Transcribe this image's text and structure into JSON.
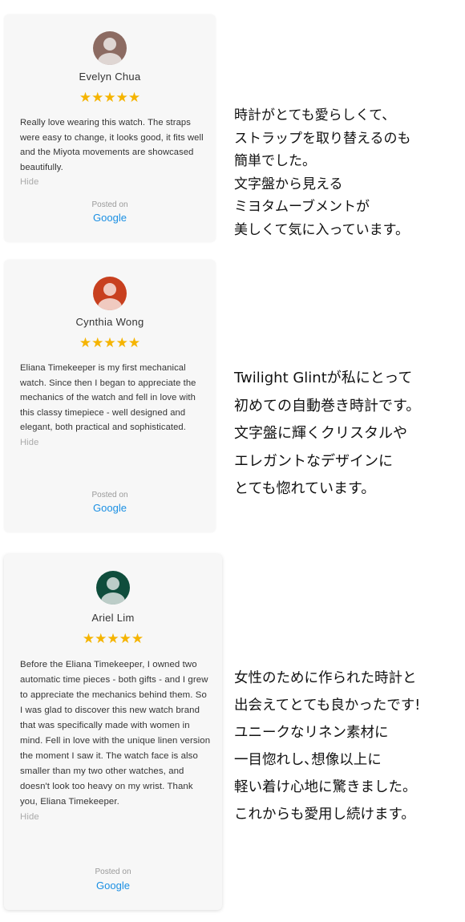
{
  "reviews": [
    {
      "name": "Evelyn Chua",
      "stars": "★★★★★",
      "rating": 5,
      "text": "Really love wearing this watch. The straps were easy to change, it looks good, it fits well and the Miyota movements are showcased beautifully.",
      "hide_label": "Hide",
      "posted_label": "Posted on",
      "source": "Google",
      "avatar_color": "#8c6b62",
      "jp_text": "時計がとても愛らしくて、\nストラップを取り替えるのも\n簡単でした。\n文字盤から見える\nミヨタムーブメントが\n美しくて気に入っています。"
    },
    {
      "name": "Cynthia Wong",
      "stars": "★★★★★",
      "rating": 5,
      "text": "Eliana Timekeeper is my first mechanical watch. Since then I began to appreciate the mechanics of the watch and fell in love with this classy timepiece - well designed and elegant, both practical and sophisticated.",
      "hide_label": "Hide",
      "posted_label": "Posted on",
      "source": "Google",
      "avatar_color": "#c8401f",
      "jp_text": "Twilight Glintが私にとって\n初めての自動巻き時計です。\n文字盤に輝くクリスタルや\nエレガントなデザインに\nとても惚れています。"
    },
    {
      "name": "Ariel Lim",
      "stars": "★★★★★",
      "rating": 5,
      "text": "Before the Eliana Timekeeper, I owned two automatic time pieces - both gifts - and I grew to appreciate the mechanics behind them. So I was glad to discover this new watch brand that was specifically made with women in mind. Fell in love with the unique linen version the moment I saw it. The watch face is also smaller than my two other watches, and doesn't look too heavy on my wrist. Thank you, Eliana Timekeeper.",
      "hide_label": "Hide",
      "posted_label": "Posted on",
      "source": "Google",
      "avatar_color": "#0f4d3c",
      "jp_text": "女性のために作られた時計と\n出会えてとても良かったです!\nユニークなリネン素材に\n一目惚れし､想像以上に\n軽い着け心地に驚きました。\nこれからも愛用し続けます。"
    }
  ],
  "colors": {
    "star": "#f5b400",
    "link": "#1a8fe3",
    "card_bg": "#f7f7f7"
  }
}
